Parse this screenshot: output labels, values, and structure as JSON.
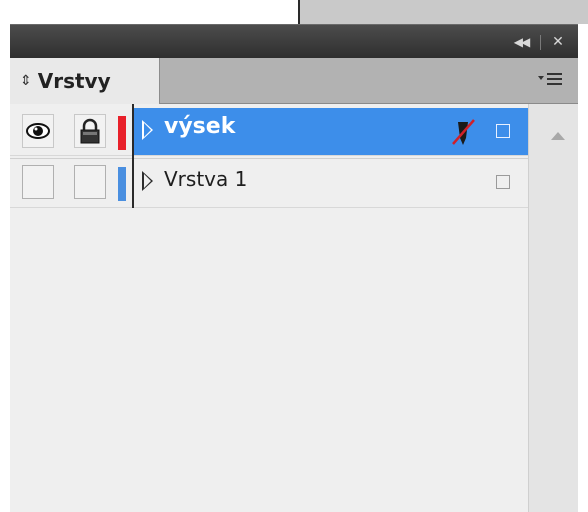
{
  "panel": {
    "title_controls": {
      "collapse": "◀◀",
      "close": "✕"
    },
    "tab": {
      "arrows": "⇕",
      "label": "Vrstvy"
    },
    "menu_icon": "panel-menu-icon"
  },
  "layers": [
    {
      "name": "výsek",
      "color": "#e8202a",
      "selected": true,
      "visible": true,
      "locked": true
    },
    {
      "name": "Vrstva 1",
      "color": "#4a8fe0",
      "selected": false,
      "visible": false,
      "locked": false
    }
  ]
}
